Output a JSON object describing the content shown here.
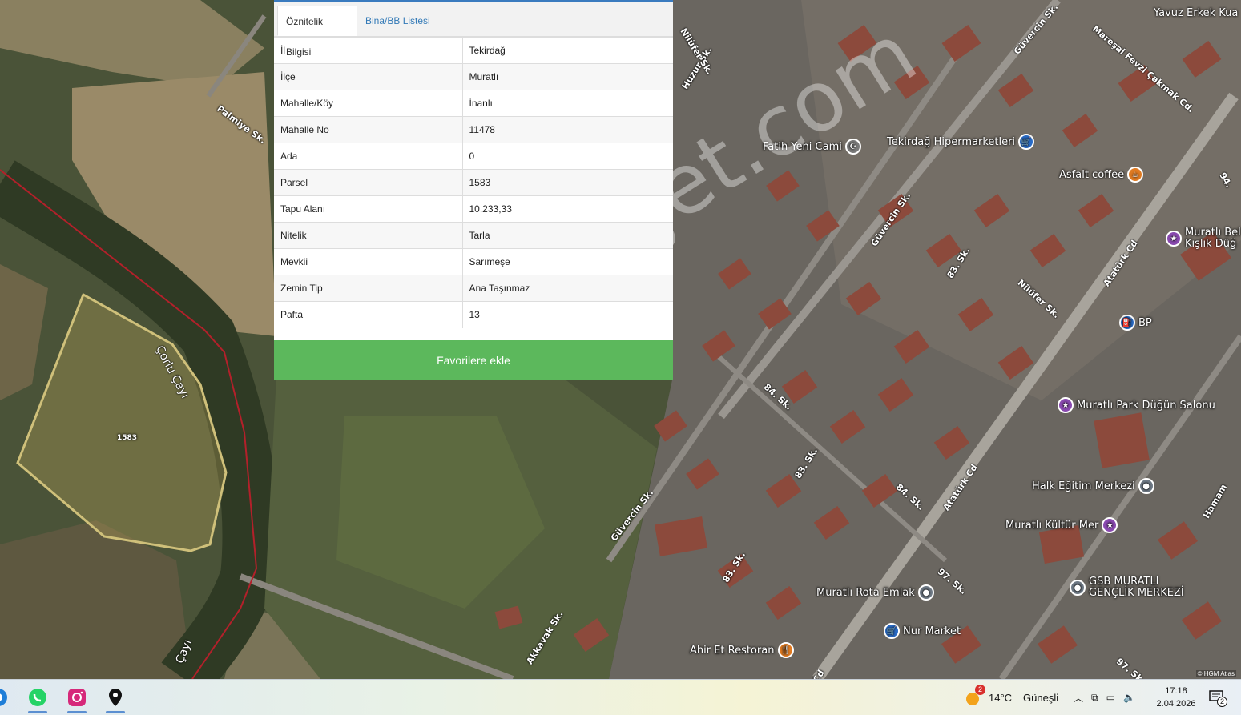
{
  "panel": {
    "tabs": [
      {
        "label": "Öznitelik Bilgisi",
        "active": true
      },
      {
        "label": "Bina/BB Listesi",
        "active": false
      }
    ],
    "rows": [
      {
        "key": "İl",
        "value": "Tekirdağ"
      },
      {
        "key": "İlçe",
        "value": "Muratlı"
      },
      {
        "key": "Mahalle/Köy",
        "value": "İnanlı"
      },
      {
        "key": "Mahalle No",
        "value": "11478"
      },
      {
        "key": "Ada",
        "value": "0"
      },
      {
        "key": "Parsel",
        "value": "1583"
      },
      {
        "key": "Tapu Alanı",
        "value": "10.233,33"
      },
      {
        "key": "Nitelik",
        "value": "Tarla"
      },
      {
        "key": "Mevkii",
        "value": "Sarımeşe"
      },
      {
        "key": "Zemin Tip",
        "value": "Ana Taşınmaz"
      },
      {
        "key": "Pafta",
        "value": "13"
      }
    ],
    "favorite_button": "Favorilere ekle",
    "accent_color": "#3a7bbf",
    "button_color": "#5cb85c"
  },
  "map": {
    "parcel_label": "1583",
    "river_label": "Çorlu Çayı",
    "river_label_bottom": "Çayı",
    "watermark": "emlakjet.com",
    "attribution": "© HGM Atlas",
    "pois": [
      {
        "name": "Yavuz Erkek Kua",
        "icon": "none"
      },
      {
        "name": "Fatih Yeni Cami",
        "icon": "mosque-icon"
      },
      {
        "name": "Tekirdağ Hipermarketleri",
        "icon": "shopping-cart-icon"
      },
      {
        "name": "Asfalt coffee",
        "icon": "coffee-icon"
      },
      {
        "name": "Muratlı Bel",
        "name2": "Kışlık Düğ",
        "icon": "venue-icon"
      },
      {
        "name": "BP",
        "icon": "fuel-icon"
      },
      {
        "name": "Muratlı Park Düğün Salonu",
        "icon": "venue-icon"
      },
      {
        "name": "Halk Eğitim Merkezi",
        "icon": "place-icon"
      },
      {
        "name": "Muratlı Kültür Mer",
        "icon": "venue-icon"
      },
      {
        "name": "GSB MURATLI",
        "name2": "GENÇLİK MERKEZİ",
        "icon": "place-icon"
      },
      {
        "name": "Muratlı Rota Emlak",
        "icon": "place-icon"
      },
      {
        "name": "Nur Market",
        "icon": "shopping-cart-icon"
      },
      {
        "name": "Ahir Et Restoran",
        "icon": "restaurant-icon"
      }
    ],
    "streets": [
      "Palmiye Sk.",
      "Huzur Sk.",
      "Nilüfer Sk.",
      "Güvercin Sk.",
      "Mareşal Fevzi Çakmak Cd.",
      "83. Sk.",
      "84. Sk.",
      "Atatürk Cd",
      "Akkavak Sk.",
      "97. Sk.",
      "Hamam",
      "94.",
      "Cd"
    ]
  },
  "taskbar": {
    "weather_temp": "14°C",
    "weather_desc": "Güneşli",
    "weather_badge": "2",
    "time": "17:18",
    "date": "2.04.2026",
    "notification_count": "2"
  }
}
